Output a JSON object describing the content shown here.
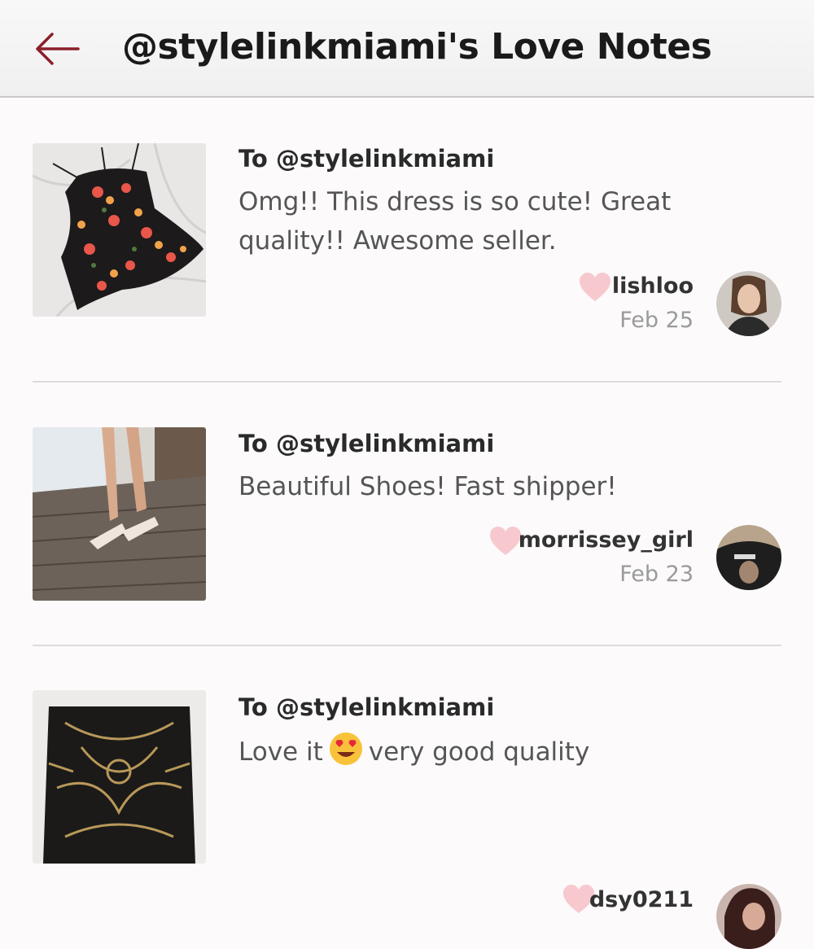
{
  "header": {
    "title": "@stylelinkmiami's Love Notes"
  },
  "notes": [
    {
      "to": "To @stylelinkmiami",
      "message": "Omg!! This dress is so cute! Great quality!! Awesome seller.",
      "author": "lishloo",
      "date": "Feb 25",
      "thumbnail": "floral-dress-image",
      "avatar": "lishloo-avatar"
    },
    {
      "to": "To @stylelinkmiami",
      "message": "Beautiful Shoes! Fast shipper!",
      "author": "morrissey_girl",
      "date": "Feb 23",
      "thumbnail": "clear-heels-image",
      "avatar": "morrissey-girl-avatar"
    },
    {
      "to": "To @stylelinkmiami",
      "message_before": "Love it",
      "message_emoji": "heart-eyes-emoji",
      "message_after": "very good quality",
      "author": "dsy0211",
      "date": "",
      "thumbnail": "embroidered-skirt-image",
      "avatar": "dsy0211-avatar"
    }
  ],
  "colors": {
    "accent": "#8b1f2a",
    "heart": "#f7c9cf"
  }
}
